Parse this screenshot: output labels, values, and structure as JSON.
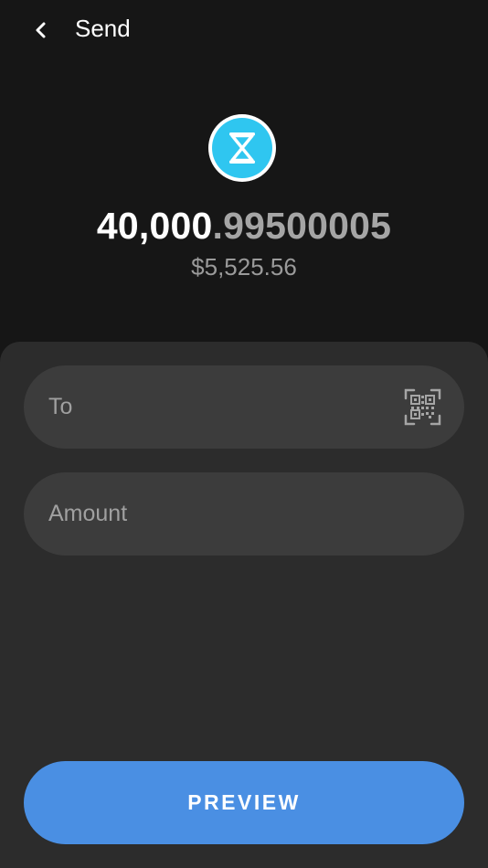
{
  "header": {
    "title": "Send",
    "back_icon": "chevron-left-icon"
  },
  "token": {
    "icon": "hourglass-token-icon",
    "accent_color": "#2fc6f0",
    "balance_integer": "40,000",
    "balance_decimal": ".99500005",
    "fiat_value": "$5,525.56"
  },
  "form": {
    "to_placeholder": "To",
    "qr_icon": "qr-code-icon",
    "amount_placeholder": "Amount"
  },
  "actions": {
    "preview_label": "PREVIEW",
    "preview_color": "#4a8fe3"
  }
}
